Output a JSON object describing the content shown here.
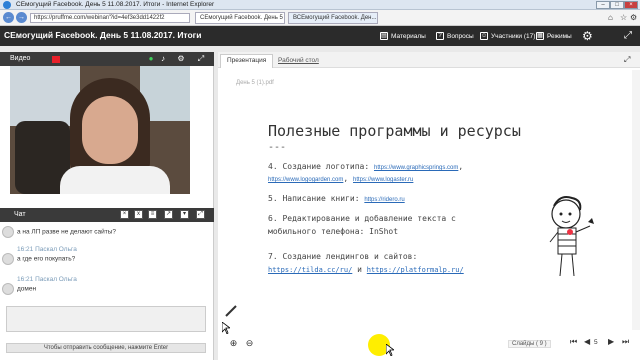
{
  "browser": {
    "window_title": "СЕмогущий Facebook. День 5 11.08.2017. Итоги - Internet Explorer",
    "url": "https://pruffme.com/webinar/?id=4ef3e3dd1422f2",
    "tabs": [
      {
        "label": "СЕмогущий Facebook. День 5 ..."
      },
      {
        "label": "ВСЕмогущий Facebook. Ден..."
      }
    ],
    "back": "←",
    "forward": "→"
  },
  "app": {
    "title": "СЕмогущий Facebook. День 5 11.08.2017. Итоги",
    "nav": [
      {
        "label": "Материалы",
        "icon": "materials-icon"
      },
      {
        "label": "Вопросы",
        "icon": "questions-icon"
      },
      {
        "label": "Участники (17)",
        "icon": "participants-icon"
      },
      {
        "label": "Режимы",
        "icon": "modes-icon"
      }
    ],
    "gear": "⚙"
  },
  "video": {
    "label": "Видео",
    "rec_color": "#e8202a"
  },
  "chat": {
    "label": "Чат",
    "messages": [
      {
        "meta": "",
        "text": "а на ЛП разве не делают сайты?"
      },
      {
        "meta": "16:21 Паскал Ольга",
        "text": "а где его покупать?"
      },
      {
        "meta": "16:21 Паскал Ольга",
        "text": "домен"
      }
    ],
    "send_hint": "Чтобы отправить сообщение, нажмите Enter"
  },
  "presentation": {
    "tab_presentation": "Презентация",
    "tab_desktop": "Рабочий стол",
    "file": "День 5 (1).pdf",
    "slide": {
      "title": "Полезные программы и ресурсы",
      "dash": "---",
      "item1_text": "4. Создание логотипа:",
      "item1_link1": "https://www.graphicsprings.com",
      "item1_link2": "https://www.logogarden.com",
      "item1_link3": "https://www.logaster.ru",
      "item2_text": "5. Написание книги:",
      "item2_link": "https://ridero.ru",
      "item3_line1": "6. Редактирование и добавление текста с",
      "item3_line2": "мобильного телефона: InShot",
      "item4_text": "7. Создание лендингов и сайтов:",
      "item4_link1": "https://tilda.cc/ru/",
      "item4_and": "и",
      "item4_link2": "https://platformalp.ru/"
    },
    "slides_label": "Слайды ( 9 )",
    "page": "5"
  }
}
